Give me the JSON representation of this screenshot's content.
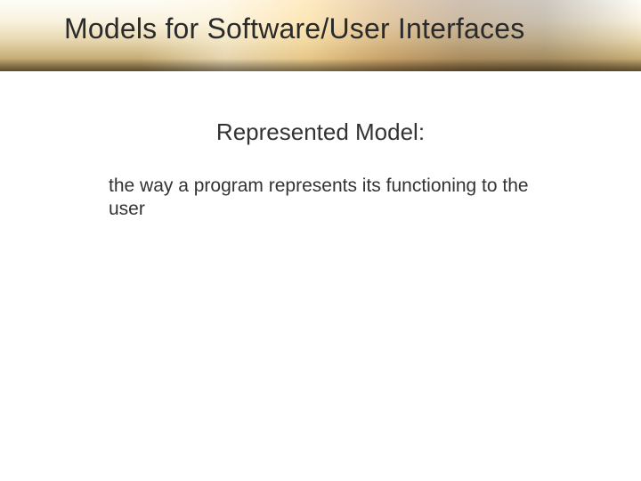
{
  "slide": {
    "title": "Models for Software/User Interfaces",
    "subtitle": "Represented Model:",
    "body": "the way a program represents its functioning to the user"
  }
}
